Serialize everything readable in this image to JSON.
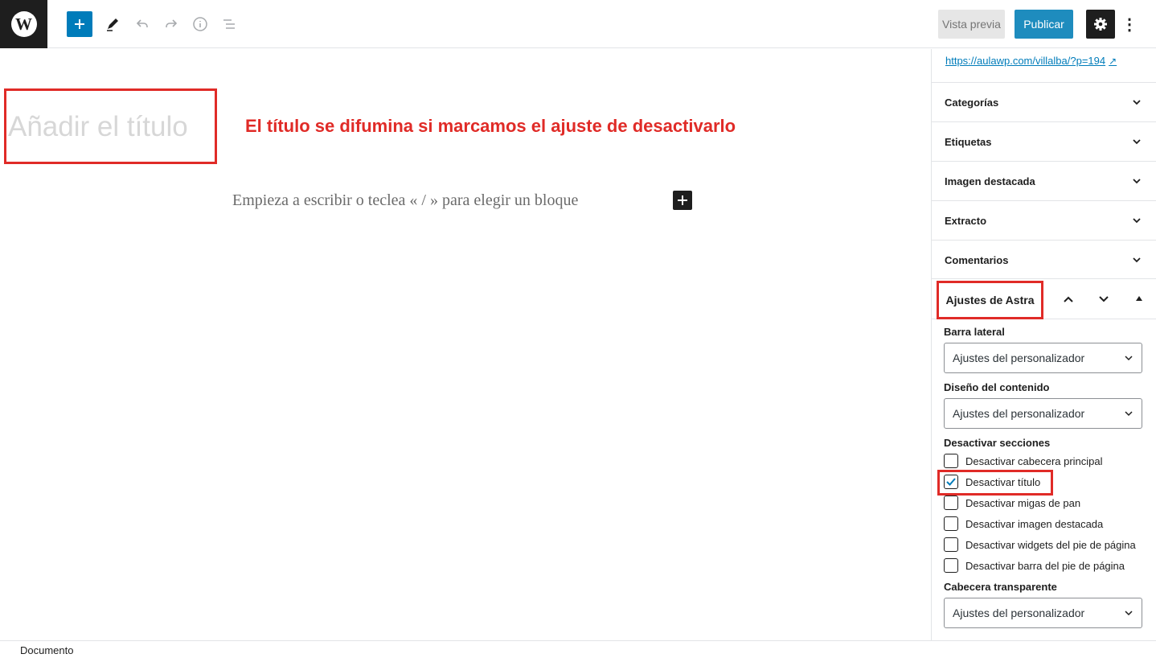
{
  "toolbar": {
    "add_block_icon": "plus-icon",
    "tools_icon": "pencil-icon",
    "undo_icon": "undo-icon",
    "redo_icon": "redo-icon",
    "info_icon": "info-icon",
    "outline_icon": "list-view-icon",
    "preview_label": "Vista previa",
    "publish_label": "Publicar",
    "settings_icon": "gear-icon",
    "more_icon": "more-vertical-icon"
  },
  "editor": {
    "title_placeholder": "Añadir el título",
    "annotation": "El título se difumina si marcamos el ajuste de desactivarlo",
    "block_placeholder": "Empieza a escribir o teclea « / » para elegir un bloque"
  },
  "sidebar": {
    "permalink": "https://aulawp.com/villalba/?p=194",
    "panels": [
      "Categorías",
      "Etiquetas",
      "Imagen destacada",
      "Extracto",
      "Comentarios"
    ],
    "astra": {
      "title": "Ajustes de Astra",
      "sidebar_label": "Barra lateral",
      "sidebar_value": "Ajustes del personalizador",
      "content_label": "Diseño del contenido",
      "content_value": "Ajustes del personalizador",
      "disable_label": "Desactivar secciones",
      "options": [
        {
          "label": "Desactivar cabecera principal",
          "checked": false
        },
        {
          "label": "Desactivar título",
          "checked": true
        },
        {
          "label": "Desactivar migas de pan",
          "checked": false
        },
        {
          "label": "Desactivar imagen destacada",
          "checked": false
        },
        {
          "label": "Desactivar widgets del pie de página",
          "checked": false
        },
        {
          "label": "Desactivar barra del pie de página",
          "checked": false
        }
      ],
      "transparent_label": "Cabecera transparente",
      "transparent_value": "Ajustes del personalizador"
    }
  },
  "footer": {
    "breadcrumb": "Documento"
  },
  "colors": {
    "accent": "#007cba",
    "highlight": "#e02b27",
    "dark": "#1e1e1e"
  }
}
